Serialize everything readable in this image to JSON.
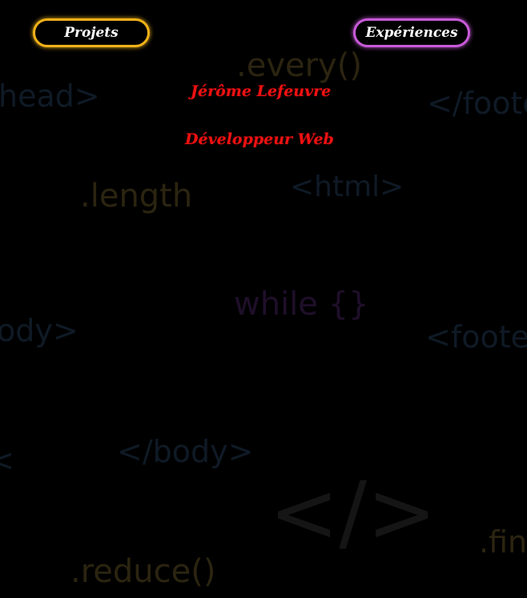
{
  "nav": {
    "projects_label": "Projets",
    "experiences_label": "Expériences",
    "projects_border_color": "#f0b21a",
    "experiences_border_color": "#c85ad8"
  },
  "hero": {
    "name": "Jérôme Lefeuvre",
    "role": "Développeur Web",
    "text_color": "#ee1111"
  },
  "background_words": {
    "every": ".every()",
    "head": "head>",
    "footer_close": "</foote",
    "length": ".length",
    "html": "<html>",
    "while": "while {}",
    "body": "ody>",
    "footer_open": "<foote",
    "body_close": "</body>",
    "lt": "<",
    "code_symbol": "</>",
    "find": ".fin",
    "reduce": ".reduce()"
  }
}
